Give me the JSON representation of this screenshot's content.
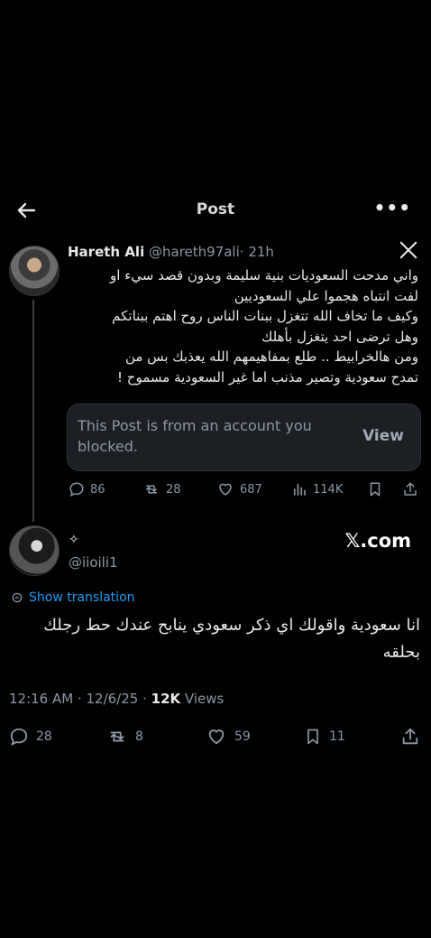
{
  "header": {
    "title": "Post",
    "more_label": "•••"
  },
  "post": {
    "author_name": "Hareth Ali",
    "author_handle": "@hareth97ali",
    "time": "· 21h",
    "lines": [
      "واني مدحت السعوديات بنية سليمة وبدون قصد سيء او",
      "لفت انتباه هجموا علي السعوديين",
      "وكيف ما تخاف الله تتغزل ببنات الناس روح اهتم ببناتكم",
      "وهل ترضى احد يتغزل بأهلك",
      "ومن هالخرابيط .. طلع بمفاهيمهم الله يعذبك بس من",
      "تمدح سعودية وتصير مذنب اما غير السعودية مسموح !"
    ],
    "quote_text": "This Post is from an account you blocked.",
    "quote_action": "View",
    "stats": {
      "replies": "86",
      "reposts": "28",
      "likes": "687",
      "views": "114K"
    }
  },
  "reply": {
    "sparkle": "✧",
    "handle": "@iioili1",
    "watermark": "𝕏.com",
    "show_translation": "Show translation",
    "lines": [
      "انا سعودية واقولك اي ذكر سعودي ينابح عندك حط رجلك",
      "بحلقه"
    ],
    "time": "12:16 AM · 12/6/25 · ",
    "views_count": "12K",
    "views_label": " Views",
    "stats": {
      "replies": "28",
      "reposts": "8",
      "likes": "59",
      "bookmarks": "11"
    }
  }
}
